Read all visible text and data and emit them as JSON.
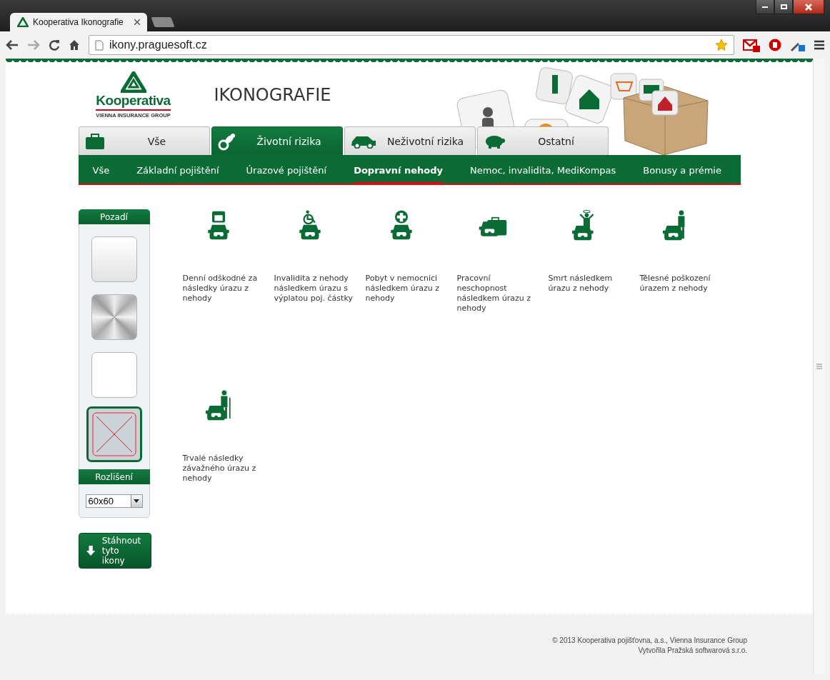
{
  "browser": {
    "tab_title": "Kooperativa Ikonografie",
    "url": "ikony.praguesoft.cz"
  },
  "header": {
    "logo_name": "Kooperativa",
    "logo_tagline": "VIENNA INSURANCE GROUP",
    "title": "IKONOGRAFIE"
  },
  "main_tabs": [
    {
      "label": "Vše",
      "kind": "briefcase",
      "selected": false
    },
    {
      "label": "Životní rizika",
      "kind": "pacifier",
      "selected": true
    },
    {
      "label": "Neživotní rizika",
      "kind": "car",
      "selected": false
    },
    {
      "label": "Ostatní",
      "kind": "piggy",
      "selected": false
    }
  ],
  "sub_nav": [
    {
      "label": "Vše",
      "selected": false
    },
    {
      "label": "Základní pojištění",
      "selected": false
    },
    {
      "label": "Úrazové pojištění",
      "selected": false
    },
    {
      "label": "Dopravní nehody",
      "selected": true
    },
    {
      "label": "Nemoc, invalidita, MediKompas",
      "selected": false
    },
    {
      "label": "Bonusy a prémie",
      "selected": false
    }
  ],
  "sidebar": {
    "background_title": "Pozadí",
    "backgrounds": [
      {
        "kind": "gradient",
        "selected": false
      },
      {
        "kind": "metal",
        "selected": false
      },
      {
        "kind": "white",
        "selected": false
      },
      {
        "kind": "none",
        "selected": true
      }
    ],
    "resolution_title": "Rozlišení",
    "resolution": {
      "value": "60x60"
    },
    "download_button": "Stáhnout tyto ikony"
  },
  "icons": [
    {
      "kind": "calendar",
      "caption": "Denní odškodné za následky úrazu z nehody"
    },
    {
      "kind": "wheelchair",
      "caption": "Invalidita z nehody následkem úrazu s výplatou poj. částky"
    },
    {
      "kind": "cross",
      "caption": "Pobyt v nemocnici následkem úrazu z nehody"
    },
    {
      "kind": "briefcase",
      "caption": "Pracovní neschopnost následkem úrazu z nehody"
    },
    {
      "kind": "angel",
      "caption": "Smrt následkem úrazu z nehody"
    },
    {
      "kind": "person",
      "caption": "Tělesné poškození úrazem z nehody"
    },
    {
      "kind": "crutch",
      "caption": "Trvalé následky závažného úrazu z nehody"
    }
  ],
  "footer": [
    "© 2013 Kooperativa pojišťovna, a.s., Vienna Insurance Group",
    "Vytvořila Pražská softwarová s.r.o."
  ]
}
